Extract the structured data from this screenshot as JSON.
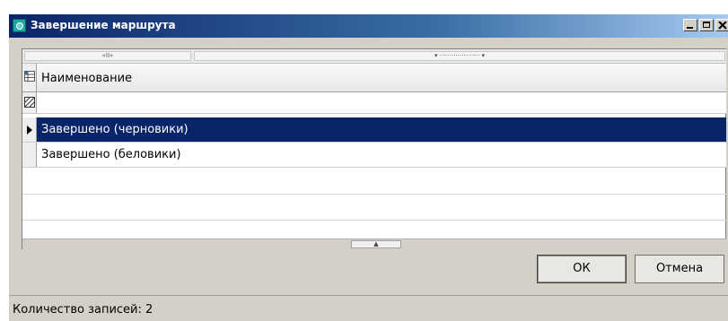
{
  "window": {
    "title": "Завершение маршрута",
    "minimize_label": "_",
    "close_label": "X"
  },
  "grid": {
    "band_left_label": "«II»",
    "band_right_label": "▾ ···················· ▾",
    "column_header": "Наименование",
    "rows": [
      {
        "label": "Завершено (черновики)",
        "selected": true
      },
      {
        "label": "Завершено (беловики)",
        "selected": false
      }
    ],
    "scroll_thumb_label": "▲"
  },
  "buttons": {
    "ok_label": "ОК",
    "cancel_label": "Отмена"
  },
  "status": {
    "text": "Количество записей: 2"
  },
  "colors": {
    "title_bar": "#0a246a",
    "selection": "#0a246a",
    "window_bg": "#d4d0c8"
  },
  "icons": {
    "app": "route-app-icon",
    "column_chooser": "column-chooser-icon",
    "filter": "filter-icon",
    "row_pointer": "row-pointer-icon"
  }
}
